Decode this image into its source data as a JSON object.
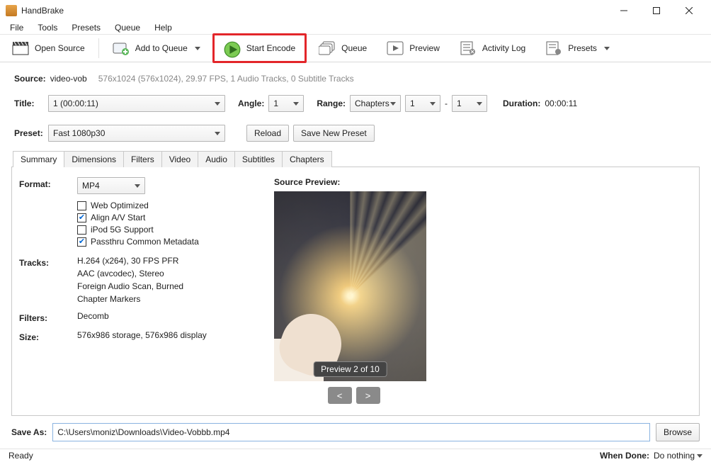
{
  "titlebar": {
    "app_name": "HandBrake"
  },
  "menubar": {
    "file": "File",
    "tools": "Tools",
    "presets": "Presets",
    "queue": "Queue",
    "help": "Help"
  },
  "toolbar": {
    "open_source": "Open Source",
    "add_to_queue": "Add to Queue",
    "start_encode": "Start Encode",
    "queue": "Queue",
    "preview": "Preview",
    "activity_log": "Activity Log",
    "presets": "Presets"
  },
  "source": {
    "label": "Source:",
    "name": "video-vob",
    "details": "576x1024 (576x1024), 29.97 FPS, 1 Audio Tracks, 0 Subtitle Tracks"
  },
  "title_row": {
    "title_label": "Title:",
    "title_value": "1  (00:00:11)",
    "angle_label": "Angle:",
    "angle_value": "1",
    "range_label": "Range:",
    "range_type": "Chapters",
    "range_from": "1",
    "range_dash": "-",
    "range_to": "1",
    "duration_label": "Duration:",
    "duration_value": "00:00:11"
  },
  "preset_row": {
    "preset_label": "Preset:",
    "preset_value": "Fast 1080p30",
    "reload": "Reload",
    "save_new": "Save New Preset"
  },
  "tabs": {
    "summary": "Summary",
    "dimensions": "Dimensions",
    "filters": "Filters",
    "video": "Video",
    "audio": "Audio",
    "subtitles": "Subtitles",
    "chapters": "Chapters"
  },
  "summary": {
    "format_label": "Format:",
    "format_value": "MP4",
    "web_optimized": "Web Optimized",
    "align_av": "Align A/V Start",
    "ipod": "iPod 5G Support",
    "passthru": "Passthru Common Metadata",
    "tracks_label": "Tracks:",
    "tracks_l1": "H.264 (x264), 30 FPS PFR",
    "tracks_l2": "AAC (avcodec), Stereo",
    "tracks_l3": "Foreign Audio Scan, Burned",
    "tracks_l4": "Chapter Markers",
    "filters_label": "Filters:",
    "filters_value": "Decomb",
    "size_label": "Size:",
    "size_value": "576x986 storage, 576x986 display",
    "source_preview": "Source Preview:",
    "preview_badge": "Preview 2 of 10",
    "prev": "<",
    "next": ">"
  },
  "saveas": {
    "label": "Save As:",
    "path": "C:\\Users\\moniz\\Downloads\\Video-Vobbb.mp4",
    "browse": "Browse"
  },
  "statusbar": {
    "ready": "Ready",
    "when_done_label": "When Done:",
    "when_done_value": "Do nothing"
  }
}
